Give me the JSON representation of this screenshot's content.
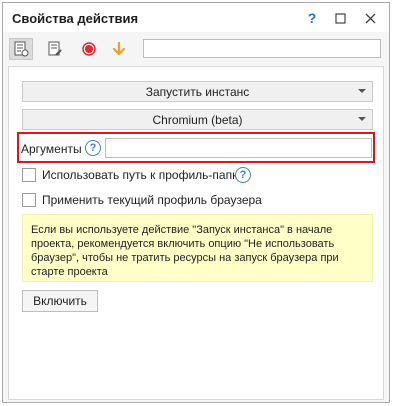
{
  "window": {
    "title": "Свойства действия",
    "help_symbol": "?",
    "maximize_symbol": "☐",
    "close_symbol": "✕"
  },
  "toolbar": {
    "tools": [
      {
        "icon": "properties-icon",
        "active": true
      },
      {
        "icon": "edit-icon",
        "active": false
      },
      {
        "icon": "record-icon",
        "active": false,
        "color": "#e8242c"
      },
      {
        "icon": "arrow-down-icon",
        "active": false,
        "color": "#f0a020"
      }
    ],
    "search_value": ""
  },
  "form": {
    "action_select": "Запустить инстанс",
    "browser_select": "Chromium (beta)",
    "arguments_label": "Аргументы",
    "arguments_value": "",
    "help_symbol": "?",
    "checkbox_profile_path": {
      "label": "Использовать путь к профиль-папке",
      "checked": false
    },
    "checkbox_apply_profile": {
      "label": "Применить текущий профиль браузера",
      "checked": false
    },
    "note": "Если вы используете действие \"Запуск инстанса\" в начале проекта, рекомендуется включить опцию \"Не использовать браузер\", чтобы не тратить ресурсы на запуск браузера при старте проекта",
    "enable_button": "Включить"
  },
  "colors": {
    "highlight": "#e0141c",
    "note_bg": "#ffffc8",
    "accent": "#3b7fd6"
  }
}
